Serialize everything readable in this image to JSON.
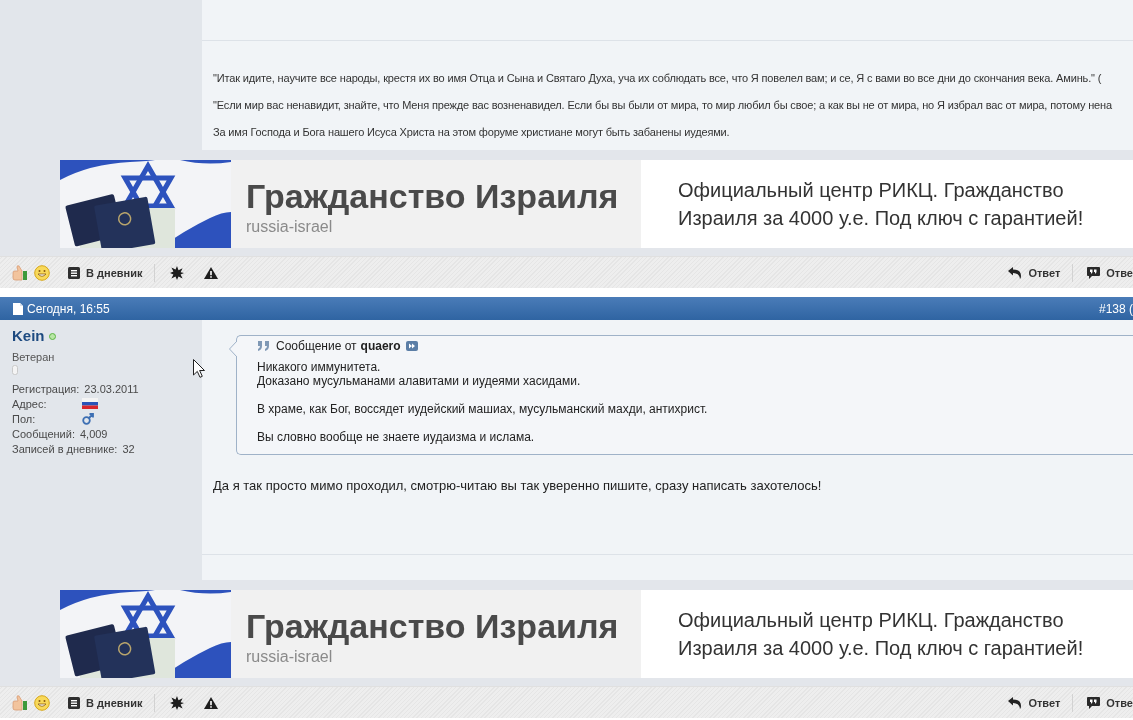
{
  "posts": [
    {
      "signature": [
        "\"Итак идите, научите все народы, крестя их во имя Отца и Сына и Святаго Духа, уча их соблюдать все, что Я повелел вам; и се, Я с вами во все дни до скончания века. Аминь.\" (",
        "\"Если мир вас ненавидит, знайте, что Меня прежде вас возненавидел. Если бы вы были от мира, то мир любил бы свое; а как вы не от мира, но Я избрал вас от мира, потому нена",
        "За имя Господа и Бога нашего Исуса Христа на этом форуме христиане могут быть забанены иудеями."
      ],
      "ad": {
        "title": "Гражданство Израиля",
        "source": "russia-israel",
        "description": "Официальный центр РИКЦ. Гражданство Израиля за 4000 у.е. Под ключ с гарантией!"
      },
      "toolbar": {
        "diary": "В дневник",
        "reply": "Ответ",
        "quote_reply": "Отве"
      }
    },
    {
      "header": {
        "date": "Сегодня, 16:55",
        "number": "#138 ("
      },
      "author": {
        "name": "Kein",
        "online": true,
        "rank": "Ветеран",
        "fields": [
          {
            "kind": "text",
            "label": "Регистрация:",
            "value": "23.03.2011"
          },
          {
            "kind": "flag",
            "label": "Адрес:"
          },
          {
            "kind": "male",
            "label": "Пол:"
          },
          {
            "kind": "text",
            "label": "Сообщений:",
            "value": "4,009"
          },
          {
            "kind": "text",
            "label": "Записей в дневнике:",
            "value": "32"
          }
        ]
      },
      "quote": {
        "label": "Сообщение от",
        "author": "quaero",
        "paragraphs": [
          "Никакого иммунитета.\nДоказано мусульманами алавитами и иудеями хасидами.",
          "В храме, как Бог, воссядет иудейский машиах, мусульманский махди, антихрист.",
          "Вы словно вообще не знаете иудаизма и ислама."
        ]
      },
      "message": "Да я так просто мимо проходил, смотрю-читаю вы так уверенно пишите, сразу написать захотелось!",
      "ad": {
        "title": "Гражданство Израиля",
        "source": "russia-israel",
        "description": "Официальный центр РИКЦ. Гражданство Израиля за 4000 у.е. Под ключ с гарантией!"
      },
      "toolbar": {
        "diary": "В дневник",
        "reply": "Ответ",
        "quote_reply": "Отве"
      }
    }
  ]
}
